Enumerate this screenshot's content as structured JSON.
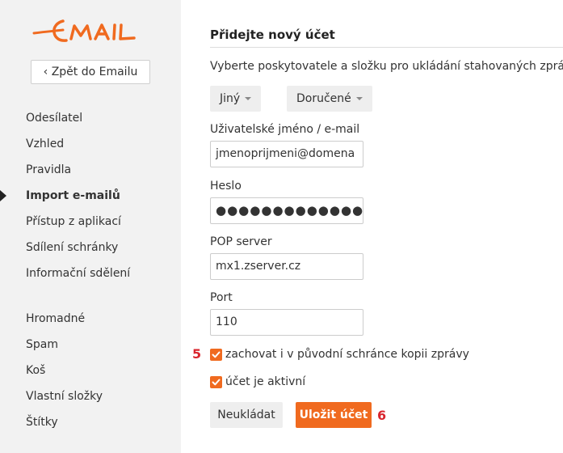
{
  "sidebar": {
    "logo_text": "EMAIL",
    "back_label": "‹ Zpět do Emailu",
    "items": [
      {
        "label": "Odesílatel"
      },
      {
        "label": "Vzhled"
      },
      {
        "label": "Pravidla"
      },
      {
        "label": "Import e-mailů"
      },
      {
        "label": "Přístup z aplikací"
      },
      {
        "label": "Sdílení schránky"
      },
      {
        "label": "Informační sdělení"
      },
      {
        "label": "Hromadné"
      },
      {
        "label": "Spam"
      },
      {
        "label": "Koš"
      },
      {
        "label": "Vlastní složky"
      },
      {
        "label": "Štítky"
      }
    ]
  },
  "form": {
    "title": "Přidejte nový účet",
    "intro": "Vyberte poskytovatele a složku pro ukládání stahovaných zpráv:",
    "provider_selected": "Jiný",
    "folder_selected": "Doručené",
    "username_label": "Uživatelské jméno / e-mail",
    "username_value": "jmenoprijmeni@domena",
    "password_label": "Heslo",
    "password_value": "●●●●●●●●●●●●●●●",
    "pop_label": "POP server",
    "pop_value": "mx1.zserver.cz",
    "port_label": "Port",
    "port_value": "110",
    "keep_copy_label": "zachovat i v původní schránce kopii zprávy",
    "active_label": "účet je aktivní",
    "cancel_label": "Neukládat",
    "save_label": "Uložit účet"
  },
  "annotations": {
    "marker_5": "5",
    "marker_6": "6"
  },
  "colors": {
    "accent": "#f06a1f",
    "marker": "#d9262e",
    "sidebar_bg": "#f2f2f2"
  }
}
